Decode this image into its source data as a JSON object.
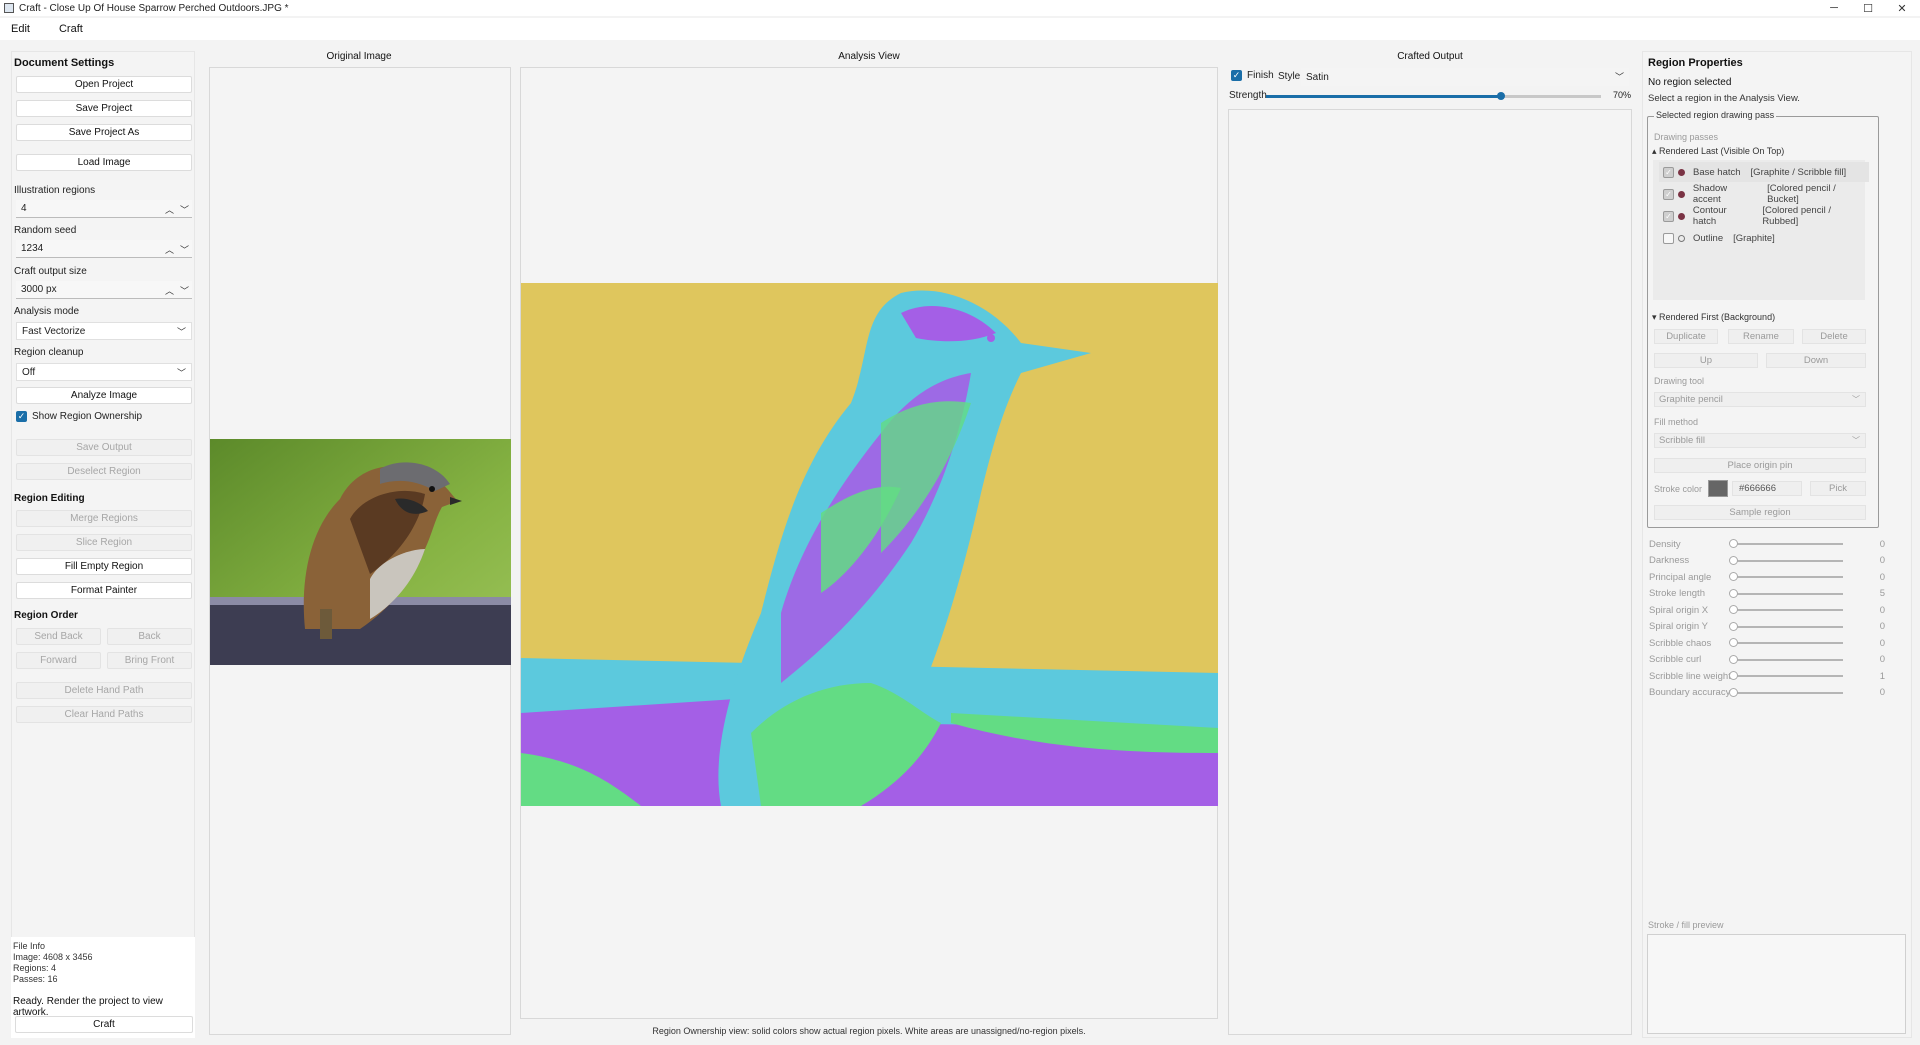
{
  "window": {
    "title": "Craft - Close Up Of House Sparrow Perched Outdoors.JPG *",
    "minimize": "─",
    "maximize": "☐",
    "close": "✕"
  },
  "menu": [
    "Edit",
    "Craft"
  ],
  "left": {
    "document_settings": "Document Settings",
    "open_project": "Open Project",
    "save_project": "Save Project",
    "save_project_as": "Save Project As",
    "load_image": "Load Image",
    "illustration_regions_label": "Illustration regions",
    "illustration_regions_value": "4",
    "random_seed_label": "Random seed",
    "random_seed_value": "1234",
    "craft_output_size_label": "Craft output size",
    "craft_output_size_value": "3000 px",
    "analysis_mode_label": "Analysis mode",
    "analysis_mode_value": "Fast Vectorize",
    "region_cleanup_label": "Region cleanup",
    "region_cleanup_value": "Off",
    "analyze_image": "Analyze Image",
    "show_region_ownership": "Show Region Ownership",
    "save_output": "Save Output",
    "deselect_region": "Deselect Region",
    "region_editing": "Region Editing",
    "merge_regions": "Merge Regions",
    "slice_region": "Slice Region",
    "fill_empty_region": "Fill Empty Region",
    "format_painter": "Format Painter",
    "region_order": "Region Order",
    "send_back": "Send Back",
    "back": "Back",
    "forward": "Forward",
    "bring_front": "Bring Front",
    "delete_hand_path": "Delete Hand Path",
    "clear_hand_paths": "Clear Hand Paths",
    "file_info": "File Info",
    "image_dims": "Image: 4608 x 3456",
    "regions": "Regions: 4",
    "passes": "Passes: 16",
    "status": "Ready. Render the project to view artwork.",
    "craft": "Craft"
  },
  "views": {
    "original_title": "Original Image",
    "analysis_title": "Analysis View",
    "crafted_title": "Crafted Output",
    "footer_note": "Region Ownership view: solid colors show actual region pixels. White areas are unassigned/no-region pixels."
  },
  "crafted": {
    "finish_label": "Finish",
    "style_label": "Style",
    "style_value": "Satin",
    "strength_label": "Strength",
    "strength_value": "70%",
    "strength_fraction": 0.7
  },
  "colors": {
    "region_yellow": "#dfc65d",
    "region_cyan": "#5cc9dd",
    "region_purple": "#a45fe6",
    "region_green": "#63dc84",
    "accent": "#1a6ea8"
  },
  "right": {
    "title": "Region Properties",
    "no_region": "No region selected",
    "hint": "Select a region in the Analysis View.",
    "group_legend": "Selected region drawing pass",
    "drawing_passes": "Drawing passes",
    "rendered_last": "▴ Rendered Last (Visible On Top)",
    "passes": [
      {
        "name": "Base hatch",
        "detail": "[Graphite / Scribble fill]",
        "checked": true,
        "dot": "#7a3344"
      },
      {
        "name": "Shadow accent",
        "detail": "[Colored pencil / Bucket]",
        "checked": true,
        "dot": "#7a3344"
      },
      {
        "name": "Contour hatch",
        "detail": "[Colored pencil / Rubbed]",
        "checked": true,
        "dot": "#7a3344"
      },
      {
        "name": "Outline",
        "detail": "[Graphite]",
        "checked": false,
        "dot": ""
      }
    ],
    "rendered_first": "▾ Rendered First (Background)",
    "duplicate": "Duplicate",
    "rename": "Rename",
    "delete": "Delete",
    "up": "Up",
    "down": "Down",
    "drawing_tool_label": "Drawing tool",
    "drawing_tool_value": "Graphite pencil",
    "fill_method_label": "Fill method",
    "fill_method_value": "Scribble fill",
    "place_origin_pin": "Place origin pin",
    "stroke_color_label": "Stroke color",
    "stroke_color_value": "#666666",
    "pick": "Pick",
    "sample_region": "Sample region",
    "sliders": [
      {
        "name": "Density",
        "value": "0"
      },
      {
        "name": "Darkness",
        "value": "0"
      },
      {
        "name": "Principal angle",
        "value": "0"
      },
      {
        "name": "Stroke length",
        "value": "5"
      },
      {
        "name": "Spiral origin X",
        "value": "0"
      },
      {
        "name": "Spiral origin Y",
        "value": "0"
      },
      {
        "name": "Scribble chaos",
        "value": "0"
      },
      {
        "name": "Scribble curl",
        "value": "0"
      },
      {
        "name": "Scribble line weight",
        "value": "1"
      },
      {
        "name": "Boundary accuracy",
        "value": "0"
      }
    ],
    "preview_label": "Stroke / fill preview"
  }
}
